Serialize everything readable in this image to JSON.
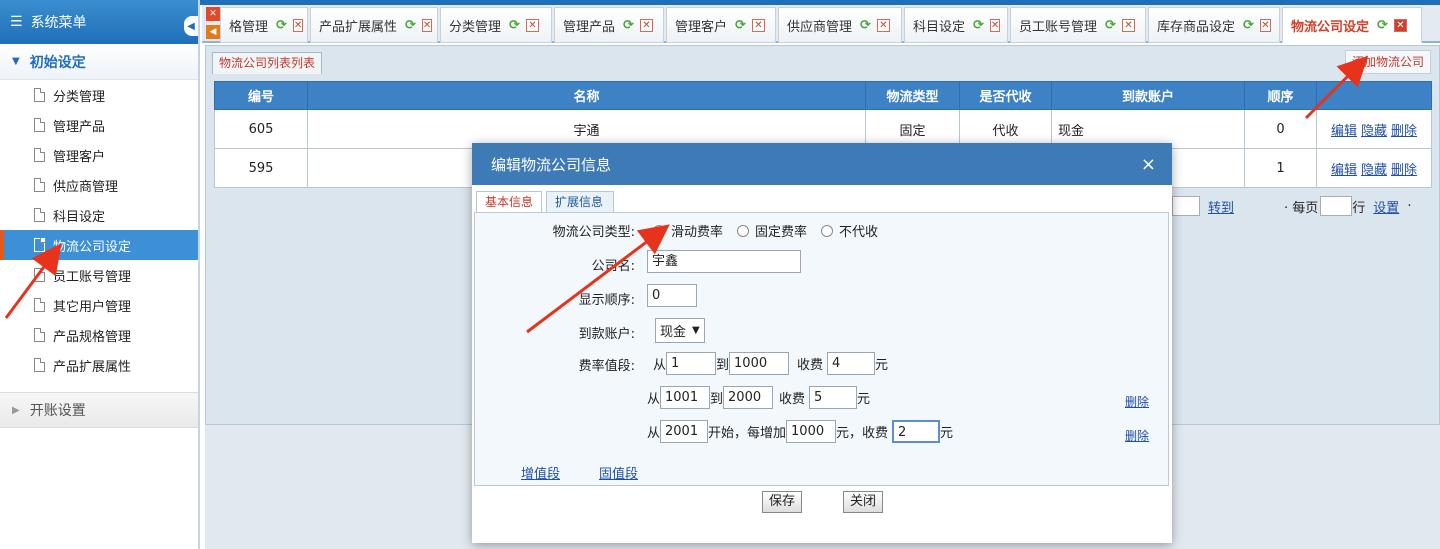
{
  "sidebar": {
    "title": "系统菜单",
    "group_init": "初始设定",
    "items": [
      {
        "label": "分类管理"
      },
      {
        "label": "管理产品"
      },
      {
        "label": "管理客户"
      },
      {
        "label": "供应商管理"
      },
      {
        "label": "科目设定"
      },
      {
        "label": "物流公司设定"
      },
      {
        "label": "员工账号管理"
      },
      {
        "label": "其它用户管理"
      },
      {
        "label": "产品规格管理"
      },
      {
        "label": "产品扩展属性"
      }
    ],
    "group_open": "开账设置"
  },
  "tabs": [
    {
      "label": "格管理"
    },
    {
      "label": "产品扩展属性"
    },
    {
      "label": "分类管理"
    },
    {
      "label": "管理产品"
    },
    {
      "label": "管理客户"
    },
    {
      "label": "供应商管理"
    },
    {
      "label": "科目设定"
    },
    {
      "label": "员工账号管理"
    },
    {
      "label": "库存商品设定"
    },
    {
      "label": "物流公司设定"
    }
  ],
  "list": {
    "tab_label": "物流公司列表列表",
    "add_link": "添加物流公司",
    "headers": [
      "编号",
      "名称",
      "物流类型",
      "是否代收",
      "到款账户",
      "顺序",
      ""
    ],
    "rows": [
      {
        "id": "605",
        "name": "宇通",
        "type": "固定",
        "collect": "代收",
        "account": "现金",
        "order": "0"
      },
      {
        "id": "595",
        "name": "",
        "type": "",
        "collect": "",
        "account": "",
        "order": "1"
      }
    ],
    "ops": {
      "edit": "编辑",
      "hide": "隐藏",
      "delete": "删除"
    },
    "pager": {
      "goto": "转到",
      "per_page_prefix": "· 每页",
      "per_page_suffix": "行",
      "settings": "设置",
      "tail": "·"
    }
  },
  "modal": {
    "title": "编辑物流公司信息",
    "close": "×",
    "tabs": {
      "basic": "基本信息",
      "ext": "扩展信息"
    },
    "type_label": "物流公司类型:",
    "type_options": [
      "滑动费率",
      "固定费率",
      "不代收"
    ],
    "type_selected": 0,
    "name_label": "公司名:",
    "name_value": "宇鑫",
    "order_label": "显示顺序:",
    "order_value": "0",
    "account_label": "到款账户:",
    "account_value": "现金",
    "rate_label": "费率值段:",
    "seg1": {
      "from_word": "从",
      "from": "1",
      "to_word": "到",
      "to": "1000",
      "fee_word": "收费",
      "fee": "4",
      "unit": "元"
    },
    "seg2": {
      "from_word": "从",
      "from": "1001",
      "to_word": "到",
      "to": "2000",
      "fee_word": "收费",
      "fee": "5",
      "unit": "元",
      "delete": "删除"
    },
    "seg3": {
      "from_word": "从",
      "from": "2001",
      "start_word": "开始，每增加",
      "step": "1000",
      "mid_word": "元，收费",
      "fee": "2",
      "unit": "元",
      "delete": "删除"
    },
    "add_seg": "增值段",
    "fix_seg": "固值段",
    "save": "保存",
    "close_btn": "关闭"
  },
  "colors": {
    "accent": "#3e7bb6",
    "active_tab": "#d0402a",
    "arrow": "#e8331c"
  }
}
